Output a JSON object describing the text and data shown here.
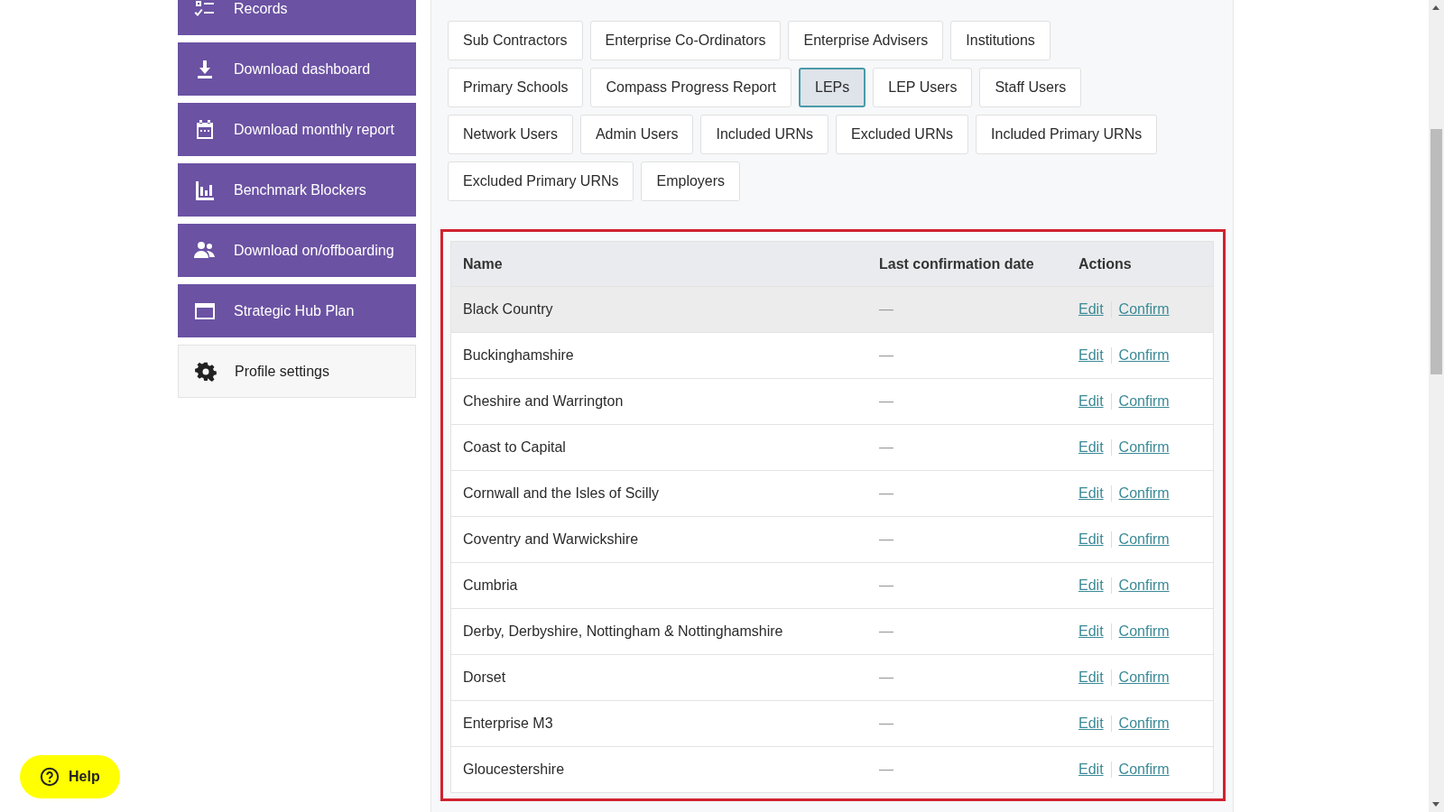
{
  "sidebar": {
    "items": [
      {
        "label": "Records",
        "kind": "primary"
      },
      {
        "label": "Download dashboard",
        "kind": "primary"
      },
      {
        "label": "Download monthly report",
        "kind": "primary"
      },
      {
        "label": "Benchmark Blockers",
        "kind": "primary"
      },
      {
        "label": "Download on/offboarding",
        "kind": "primary"
      },
      {
        "label": "Strategic Hub Plan",
        "kind": "primary"
      },
      {
        "label": "Profile settings",
        "kind": "plain"
      }
    ]
  },
  "record_types": [
    [
      {
        "label": "Sub Contractors",
        "selected": false
      },
      {
        "label": "Enterprise Co-Ordinators",
        "selected": false
      },
      {
        "label": "Enterprise Advisers",
        "selected": false
      },
      {
        "label": "Institutions",
        "selected": false
      }
    ],
    [
      {
        "label": "Primary Schools",
        "selected": false
      },
      {
        "label": "Compass Progress Report",
        "selected": false
      },
      {
        "label": "LEPs",
        "selected": true
      },
      {
        "label": "LEP Users",
        "selected": false
      },
      {
        "label": "Staff Users",
        "selected": false
      }
    ],
    [
      {
        "label": "Network Users",
        "selected": false
      },
      {
        "label": "Admin Users",
        "selected": false
      },
      {
        "label": "Included URNs",
        "selected": false
      },
      {
        "label": "Excluded URNs",
        "selected": false
      },
      {
        "label": "Included Primary URNs",
        "selected": false
      }
    ],
    [
      {
        "label": "Excluded Primary URNs",
        "selected": false
      },
      {
        "label": "Employers",
        "selected": false
      }
    ]
  ],
  "table": {
    "highlighted": true,
    "columns": [
      "Name",
      "Last confirmation date",
      "Actions"
    ],
    "rows": [
      {
        "name": "Black Country",
        "date": "—",
        "actions": [
          "Edit",
          "Confirm"
        ],
        "hovered": true
      },
      {
        "name": "Buckinghamshire",
        "date": "—",
        "actions": [
          "Edit",
          "Confirm"
        ],
        "hovered": false
      },
      {
        "name": "Cheshire and Warrington",
        "date": "—",
        "actions": [
          "Edit",
          "Confirm"
        ],
        "hovered": false
      },
      {
        "name": "Coast to Capital",
        "date": "—",
        "actions": [
          "Edit",
          "Confirm"
        ],
        "hovered": false
      },
      {
        "name": "Cornwall and the Isles of Scilly",
        "date": "—",
        "actions": [
          "Edit",
          "Confirm"
        ],
        "hovered": false
      },
      {
        "name": "Coventry and Warwickshire",
        "date": "—",
        "actions": [
          "Edit",
          "Confirm"
        ],
        "hovered": false
      },
      {
        "name": "Cumbria",
        "date": "—",
        "actions": [
          "Edit",
          "Confirm"
        ],
        "hovered": false
      },
      {
        "name": "Derby, Derbyshire, Nottingham & Nottinghamshire",
        "date": "—",
        "actions": [
          "Edit",
          "Confirm"
        ],
        "hovered": false
      },
      {
        "name": "Dorset",
        "date": "—",
        "actions": [
          "Edit",
          "Confirm"
        ],
        "hovered": false
      },
      {
        "name": "Enterprise M3",
        "date": "—",
        "actions": [
          "Edit",
          "Confirm"
        ],
        "hovered": false
      },
      {
        "name": "Gloucestershire",
        "date": "—",
        "actions": [
          "Edit",
          "Confirm"
        ],
        "hovered": false
      }
    ]
  },
  "help_button": {
    "label": "Help"
  }
}
